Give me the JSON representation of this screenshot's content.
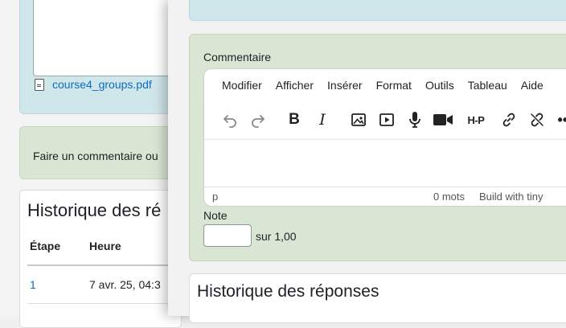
{
  "background": {
    "file_link": "course4_groups.pdf",
    "comment_prompt": "Faire un commentaire ou",
    "history": {
      "title": "Historique des ré",
      "headers": [
        "Étape",
        "Heure"
      ],
      "rows": [
        {
          "step": "1",
          "time": "7 avr. 25, 04:3"
        }
      ]
    }
  },
  "grading": {
    "comment_label": "Commentaire",
    "editor": {
      "menu": [
        "Modifier",
        "Afficher",
        "Insérer",
        "Format",
        "Outils",
        "Tableau",
        "Aide"
      ],
      "toolbar": [
        "undo-icon",
        "redo-icon",
        "bold-icon",
        "italic-icon",
        "image-icon",
        "media-icon",
        "microphone-icon",
        "video-camera-icon",
        "h5p-icon",
        "link-icon",
        "unlink-icon",
        "more-icon"
      ],
      "status_path": "p",
      "word_count": "0 mots",
      "branding": "Build with tiny"
    },
    "note_label": "Note",
    "note_value": "",
    "note_max": "sur 1,00",
    "history_title": "Historique des réponses"
  }
}
